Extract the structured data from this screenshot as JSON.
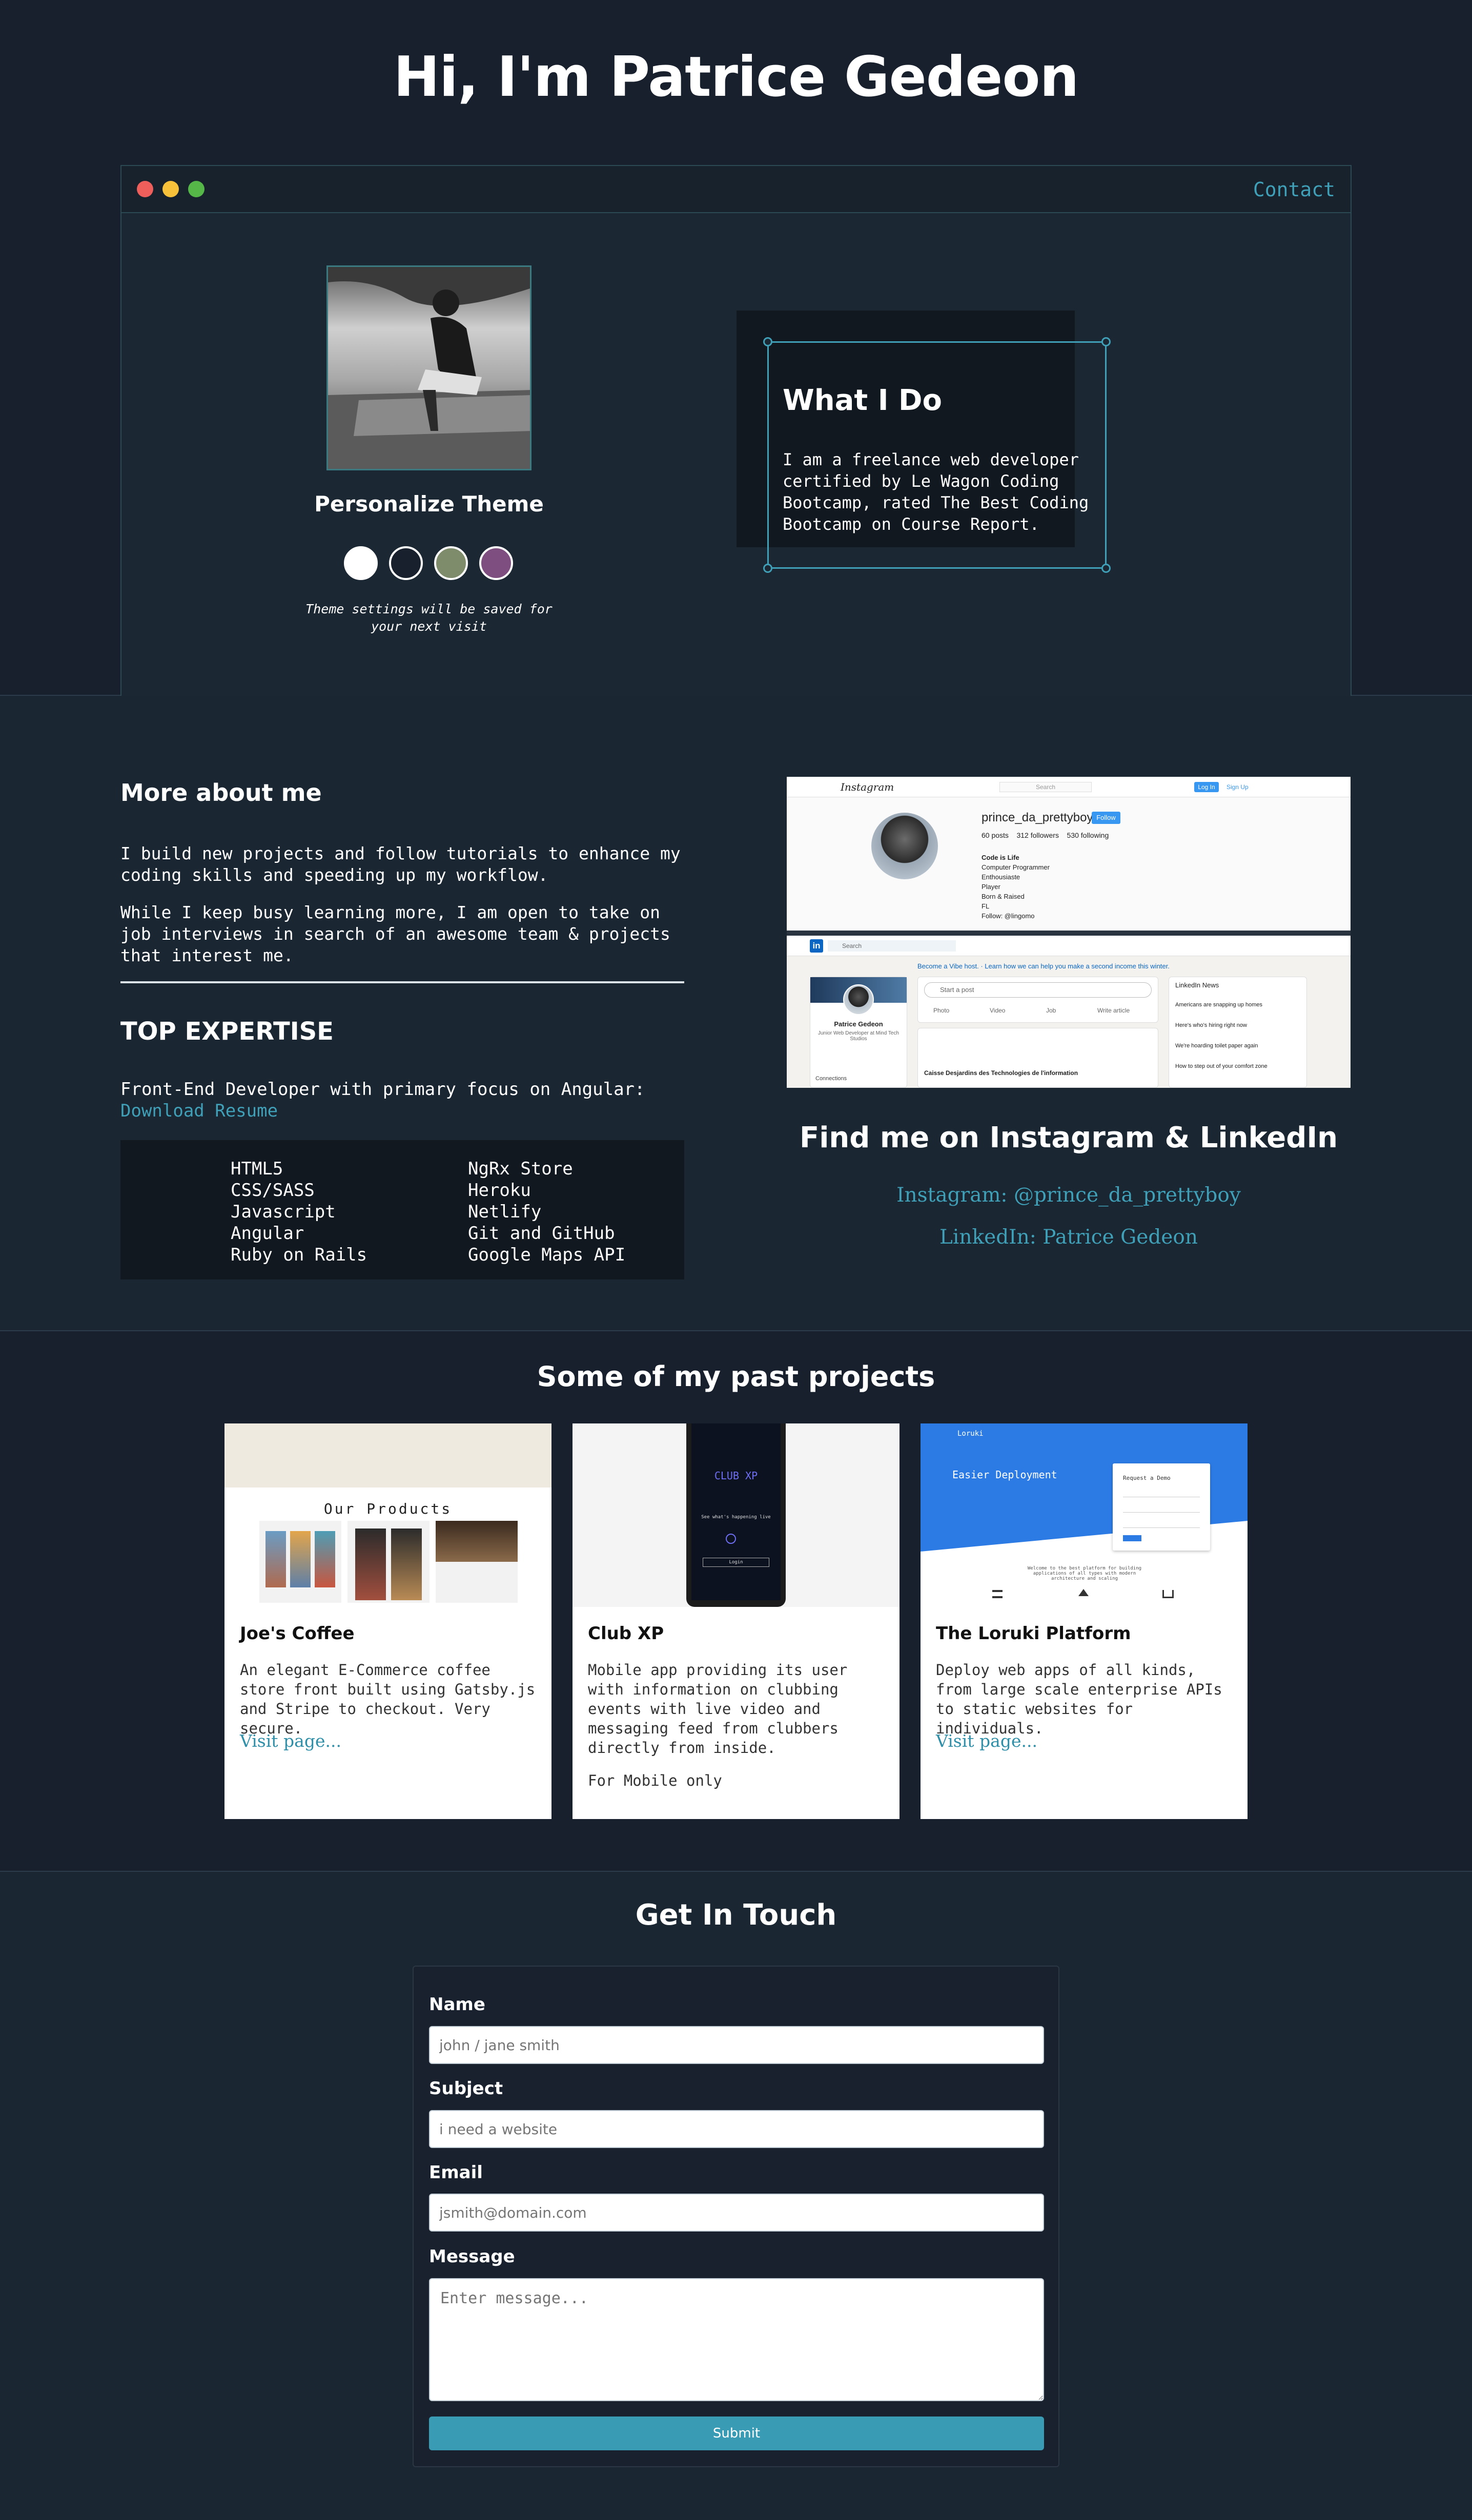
{
  "hero": {
    "title": "Hi, I'm Patrice Gedeon"
  },
  "window": {
    "contact_label": "Contact",
    "traffic_colors": [
      "#ee5f5b",
      "#f8c13a",
      "#54b748"
    ]
  },
  "theme": {
    "title": "Personalize Theme",
    "note": "Theme settings will be saved for your next visit",
    "swatches": [
      "#ffffff",
      "#17202c",
      "#7f8c6b",
      "#7d4e7f"
    ]
  },
  "what_i_do": {
    "title": "What I Do",
    "text": "I am a freelance web developer certified by Le Wagon Coding Bootcamp, rated The Best Coding Bootcamp on Course Report."
  },
  "about": {
    "title": "More about me",
    "para1": "I build new projects and follow tutorials to enhance my coding skills and speeding up my workflow.",
    "para2": "While I keep busy learning more, I am open to take on job interviews in search of an awesome team & projects that interest me."
  },
  "expertise": {
    "title": "TOP EXPERTISE",
    "focus": "Front-End Developer with primary focus on Angular:",
    "resume_link": "Download Resume",
    "skills_left": [
      "HTML5",
      "CSS/SASS",
      "Javascript",
      "Angular",
      "Ruby on Rails"
    ],
    "skills_right": [
      "NgRx Store",
      "Heroku",
      "Netlify",
      "Git and GitHub",
      "Google Maps API"
    ]
  },
  "social": {
    "title": "Find me on Instagram & LinkedIn",
    "instagram": "Instagram: @prince_da_prettyboy",
    "linkedin": "LinkedIn: Patrice Gedeon",
    "screenshot": {
      "ig_brand": "Instagram",
      "ig_search": "Search",
      "ig_login": "Log In",
      "ig_signup": "Sign Up",
      "ig_user": "prince_da_prettyboy",
      "ig_follow": "Follow",
      "ig_stats": "60 posts    312 followers    530 following",
      "ig_bio": [
        "Code is Life",
        "Computer Programmer",
        "Enthousiaste",
        "Player",
        "Born & Raised",
        "FL",
        "Follow: @lingomo"
      ],
      "li_search": "Search",
      "li_banner": "Become a Vibe host. · Learn how we can help you make a second income this winter.",
      "li_name": "Patrice Gedeon",
      "li_role": "Junior Web Developer at Mind Tech Studios",
      "li_start_post": "Start a post",
      "li_post_actions": [
        "Photo",
        "Video",
        "Job",
        "Write article"
      ],
      "li_news_title": "LinkedIn News",
      "li_news": [
        "Americans are snapping up homes",
        "Here's who's hiring right now",
        "We're hoarding toilet paper again",
        "How to step out of your comfort zone"
      ],
      "li_feed_item": "Caisse Desjardins des Technologies de l'information",
      "li_connections": "Connections"
    }
  },
  "projects": {
    "title": "Some of my past projects",
    "items": [
      {
        "title": "Joe's Coffee",
        "desc": "An elegant E-Commerce coffee store front built using Gatsby.js and Stripe to checkout. Very secure.",
        "link": "Visit page...",
        "img_heading": "Our Products"
      },
      {
        "title": "Club XP",
        "desc": "Mobile app providing its user with information on clubbing events with live video and messaging feed from clubbers directly from inside.",
        "note": "For Mobile only",
        "img_heading": "CLUB XP",
        "img_sub": "See what's happening live",
        "img_button": "Login"
      },
      {
        "title": "The Loruki Platform",
        "desc": "Deploy web apps of all kinds, from large scale enterprise APIs to static websites for individuals.",
        "link": "Visit page...",
        "img_brand": "Loruki",
        "img_heading": "Easier Deployment",
        "img_form_title": "Request a Demo",
        "img_caption": "Welcome to the best platform for building applications of all types with modern architecture and scaling"
      }
    ]
  },
  "contact_form": {
    "title": "Get In Touch",
    "name_label": "Name",
    "name_placeholder": "john / jane smith",
    "subject_label": "Subject",
    "subject_placeholder": "i need a website",
    "email_label": "Email",
    "email_placeholder": "jsmith@domain.com",
    "message_label": "Message",
    "message_placeholder": "Enter message...",
    "submit_label": "Submit"
  }
}
